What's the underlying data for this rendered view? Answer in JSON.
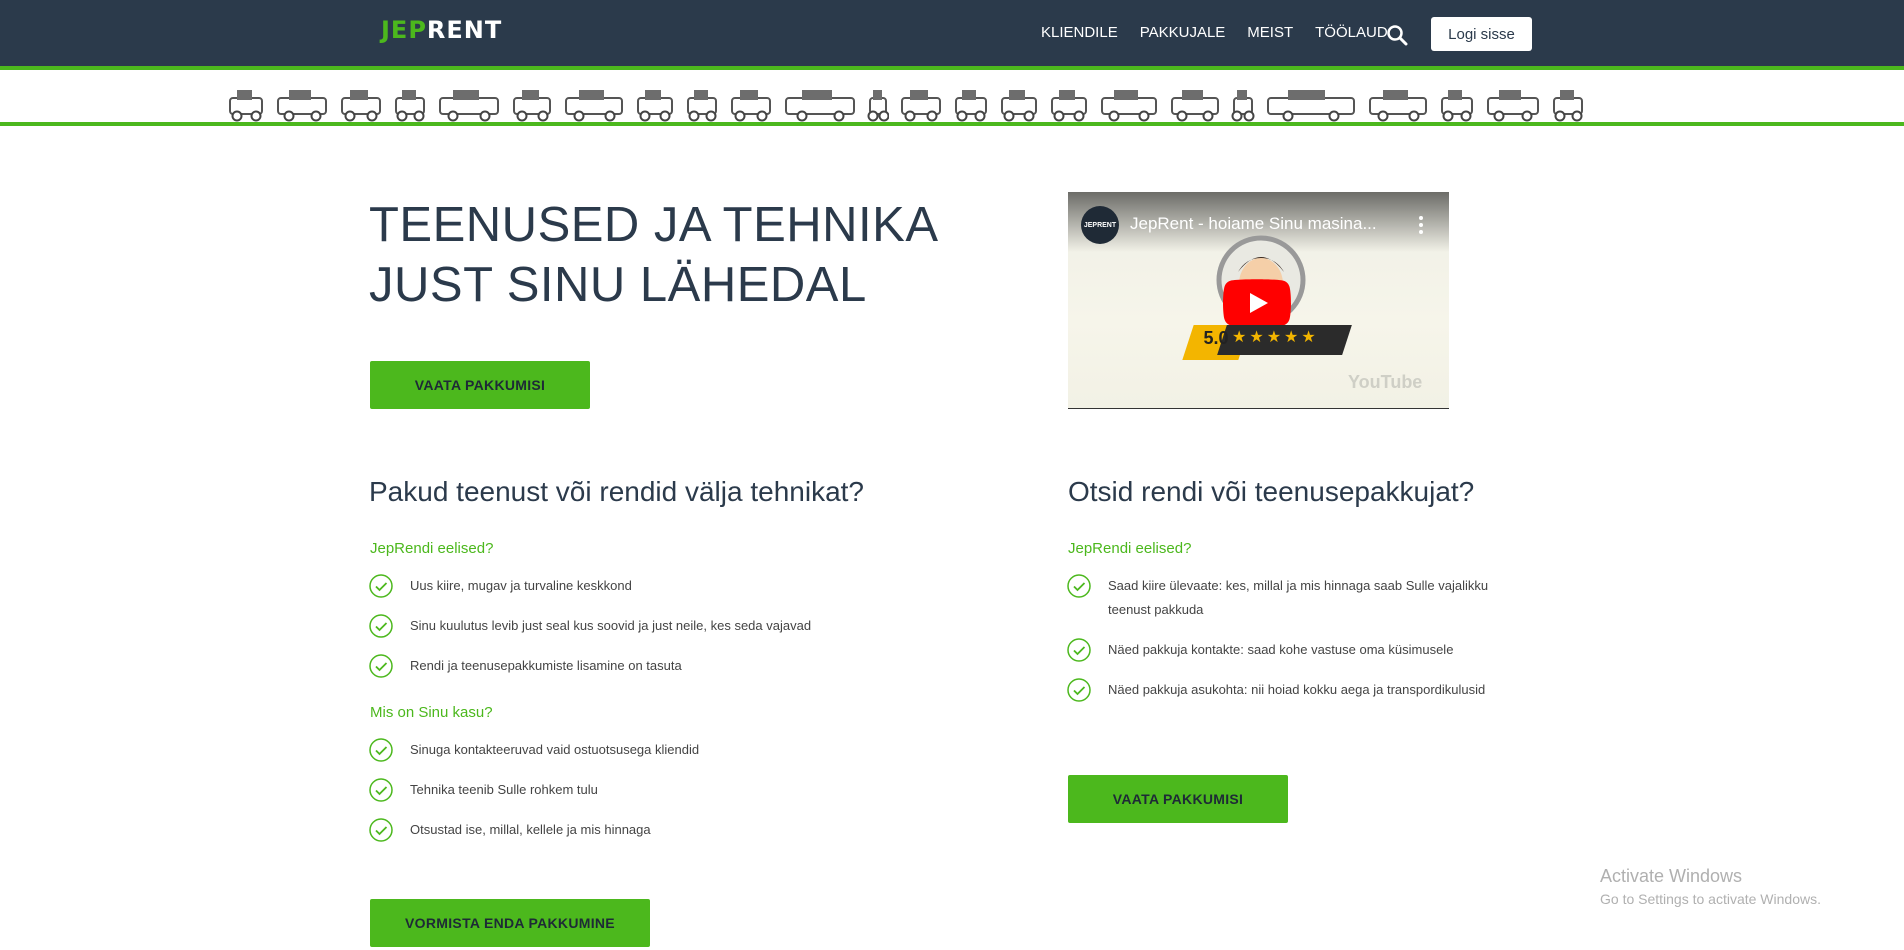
{
  "header": {
    "logo_part1": "JEP",
    "logo_part2": "RENT",
    "nav": [
      "KLIENDILE",
      "PAKKUJALE",
      "MEIST",
      "TÖÖLAUD"
    ],
    "login_label": "Logi sisse"
  },
  "hero": {
    "title_line1": "TEENUSED JA TEHNIKA",
    "title_line2": "JUST SINU LÄHEDAL",
    "button_label": "VAATA PAKKUMISI"
  },
  "video": {
    "channel_avatar_text": "JEPRENT",
    "title": "JepRent - hoiame Sinu masina...",
    "rating": "5.0",
    "stars": "★★★★★",
    "watermark": "YouTube"
  },
  "provider": {
    "heading": "Pakud teenust või rendid välja tehnikat?",
    "benefits_heading": "JepRendi eelised?",
    "benefits": [
      "Uus kiire, mugav ja turvaline keskkond",
      "Sinu kuulutus levib just seal kus soovid ja just neile, kes seda vajavad",
      "Rendi ja teenusepakkumiste lisamine on tasuta"
    ],
    "gain_heading": "Mis on Sinu kasu?",
    "gains": [
      "Sinuga kontakteeruvad vaid ostuotsusega kliendid",
      "Tehnika teenib Sulle rohkem tulu",
      "Otsustad ise, millal, kellele ja mis hinnaga"
    ],
    "button_label": "VORMISTA ENDA PAKKUMINE"
  },
  "seeker": {
    "heading": "Otsid rendi või teenusepakkujat?",
    "benefits_heading": "JepRendi eelised?",
    "benefits": [
      "Saad kiire ülevaate: kes, millal ja mis hinnaga saab Sulle vajalikku",
      "teenust pakkuda",
      "Näed pakkuja kontakte: saad kohe vastuse oma küsimusele",
      "Näed pakkuja asukohta: nii hoiad kokku aega ja transpordikulusid"
    ],
    "button_label": "VAATA PAKKUMISI"
  },
  "watermark": {
    "line1": "Activate Windows",
    "line2": "Go to Settings to activate Windows."
  },
  "colors": {
    "brand_green": "#4cb81d",
    "header_navy": "#2b3a4b"
  }
}
